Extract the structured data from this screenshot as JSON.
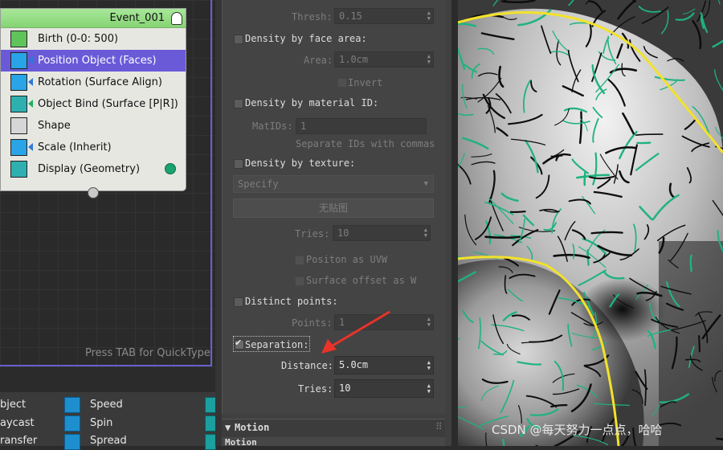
{
  "particle_view": {
    "event": {
      "title": "Event_001",
      "operators": [
        {
          "label": "Birth (0-0: 500)"
        },
        {
          "label": "Position Object (Faces)"
        },
        {
          "label": "Rotation (Surface Align)"
        },
        {
          "label": "Object Bind (Surface [P|R])"
        },
        {
          "label": "Shape"
        },
        {
          "label": "Scale (Inherit)"
        },
        {
          "label": "Display (Geometry)"
        }
      ]
    },
    "quicktype_hint": "Press TAB for QuickType",
    "depot": {
      "col1": [
        "bject",
        "aycast",
        "ransfer"
      ],
      "col2": [
        "Speed",
        "Spin",
        "Spread"
      ]
    }
  },
  "panel": {
    "thresh": {
      "label": "Thresh:",
      "value": "0.15"
    },
    "density_face_area": {
      "label": "Density by face area:"
    },
    "area": {
      "label": "Area:",
      "value": "1.0cm"
    },
    "invert": {
      "label": "Invert"
    },
    "density_material": {
      "label": "Density by material ID:"
    },
    "matids": {
      "label": "MatIDs:",
      "value": "1",
      "hint": "Separate IDs with commas"
    },
    "density_texture": {
      "label": "Density by texture:"
    },
    "specify": {
      "value": "Specify"
    },
    "no_map": {
      "label": "无贴图"
    },
    "tries_texture": {
      "label": "Tries:",
      "value": "10"
    },
    "position_uvw": {
      "label": "Positon as UVW"
    },
    "surface_offset": {
      "label": "Surface offset as W"
    },
    "distinct_points": {
      "label": "Distinct points:"
    },
    "points": {
      "label": "Points:",
      "value": "1"
    },
    "separation": {
      "label": "Separation:",
      "checked": true
    },
    "distance": {
      "label": "Distance:",
      "value": "5.0cm"
    },
    "tries": {
      "label": "Tries:",
      "value": "10"
    },
    "motion": {
      "label": "Motion",
      "sub": "Motion"
    }
  },
  "watermark": "CSDN @每天努力一点点，哈哈",
  "colors": {
    "event_header": "#92db7f",
    "selected_operator": "#6a5ad8",
    "viewport_outline": "#f2e22a",
    "annotation_arrow": "#e8332a",
    "grass": "#1fb37e"
  }
}
